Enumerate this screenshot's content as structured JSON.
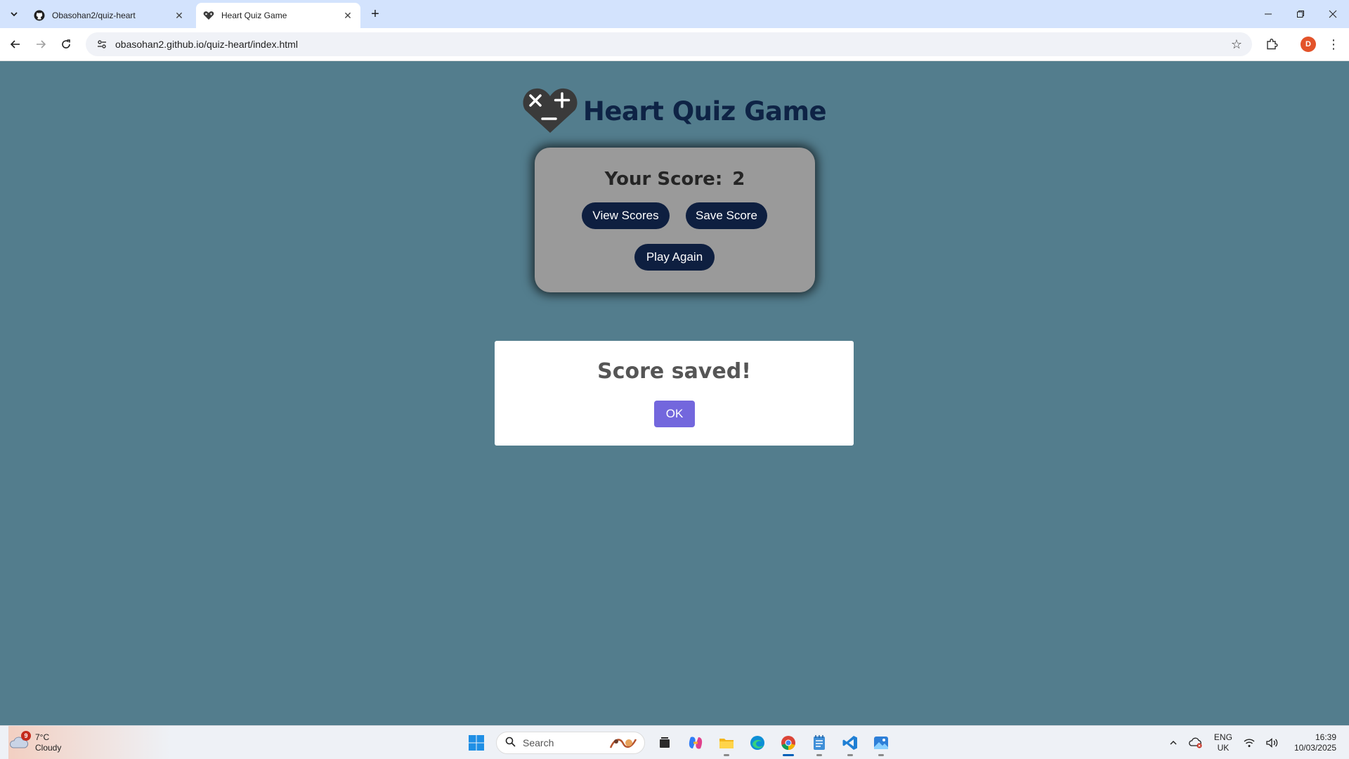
{
  "browser": {
    "tabs": [
      {
        "title": "Obasohan2/quiz-heart",
        "icon": "github-icon",
        "active": false
      },
      {
        "title": "Heart Quiz Game",
        "icon": "heart-favicon-icon",
        "active": true
      }
    ],
    "url": "obasohan2.github.io/quiz-heart/index.html",
    "profile_initial": "D"
  },
  "page": {
    "title": "Heart Quiz Game",
    "score_label": "Your Score:",
    "score_value": "2",
    "buttons": {
      "view_scores": "View Scores",
      "save_score": "Save Score",
      "play_again": "Play Again"
    },
    "dialog": {
      "title": "Score saved!",
      "ok_label": "OK"
    }
  },
  "colors": {
    "page_background": "#537d8d",
    "title_color": "#0e2345",
    "card_background": "#9a9a9a",
    "pill_button": "#0e1f40",
    "ok_button": "#7367dd"
  },
  "taskbar": {
    "weather": {
      "temp": "7°C",
      "condition": "Cloudy",
      "badge": "9"
    },
    "search_placeholder": "Search",
    "language": {
      "line1": "ENG",
      "line2": "UK"
    },
    "time": "16:39",
    "date": "10/03/2025"
  }
}
